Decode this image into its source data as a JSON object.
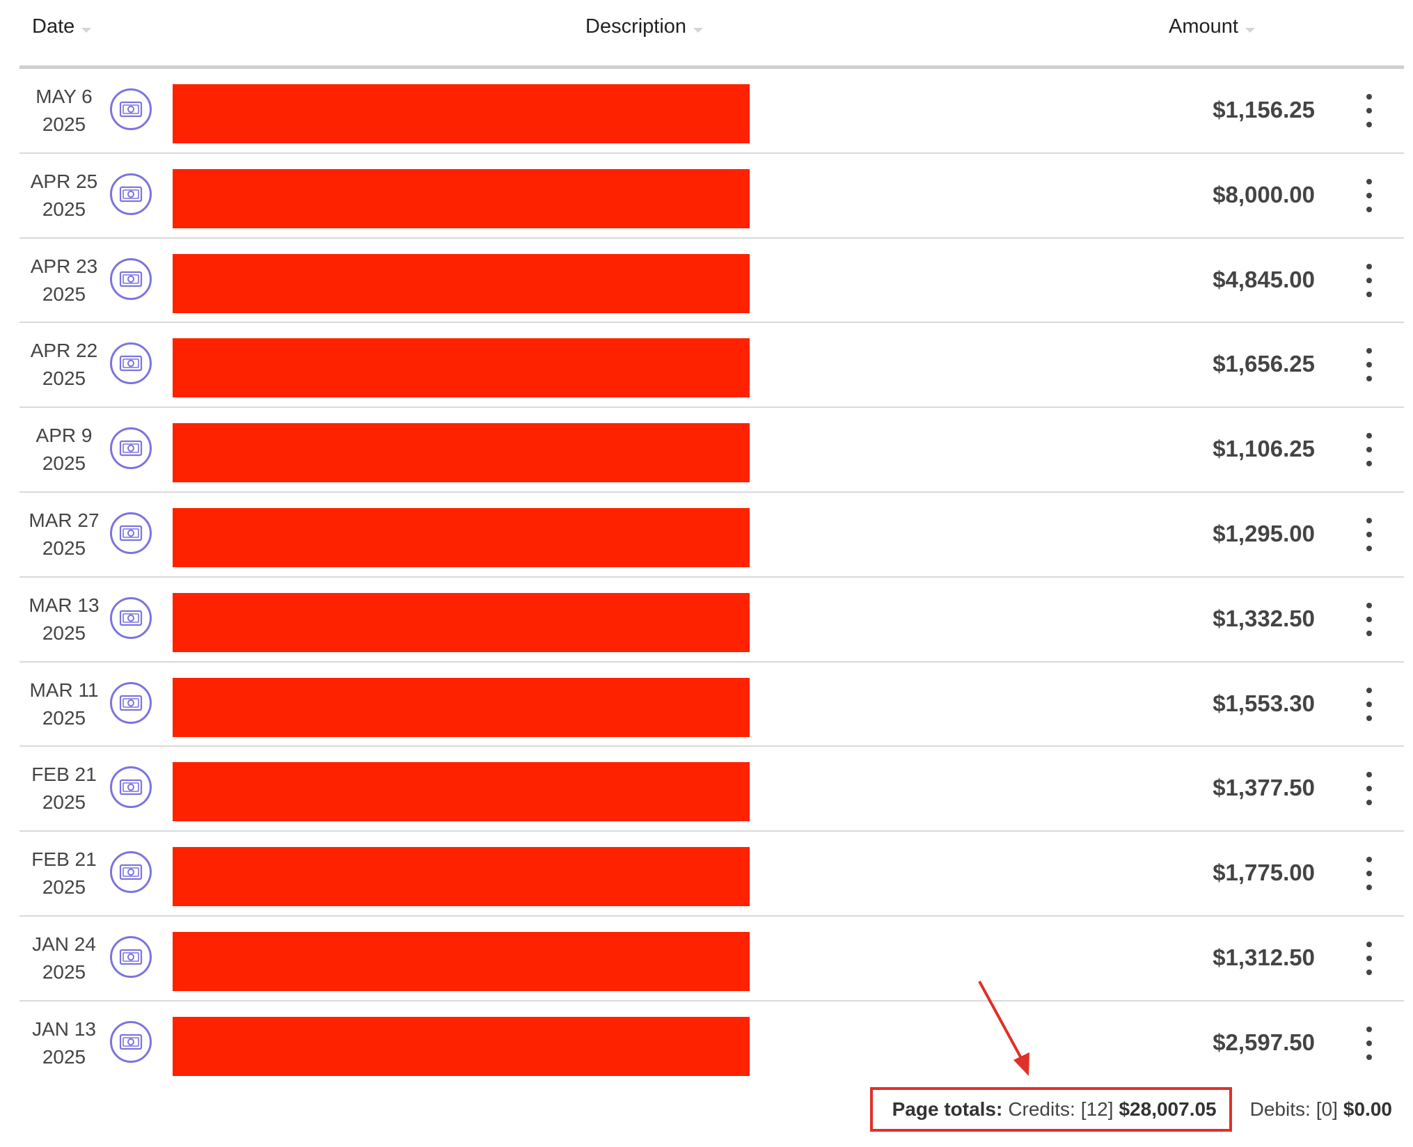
{
  "headers": {
    "date": "Date",
    "description": "Description",
    "amount": "Amount"
  },
  "rows": [
    {
      "date_md": "MAY 6",
      "year": "2025",
      "amount": "$1,156.25"
    },
    {
      "date_md": "APR 25",
      "year": "2025",
      "amount": "$8,000.00"
    },
    {
      "date_md": "APR 23",
      "year": "2025",
      "amount": "$4,845.00"
    },
    {
      "date_md": "APR 22",
      "year": "2025",
      "amount": "$1,656.25"
    },
    {
      "date_md": "APR 9",
      "year": "2025",
      "amount": "$1,106.25"
    },
    {
      "date_md": "MAR 27",
      "year": "2025",
      "amount": "$1,295.00"
    },
    {
      "date_md": "MAR 13",
      "year": "2025",
      "amount": "$1,332.50"
    },
    {
      "date_md": "MAR 11",
      "year": "2025",
      "amount": "$1,553.30"
    },
    {
      "date_md": "FEB 21",
      "year": "2025",
      "amount": "$1,377.50"
    },
    {
      "date_md": "FEB 21",
      "year": "2025",
      "amount": "$1,775.00"
    },
    {
      "date_md": "JAN 24",
      "year": "2025",
      "amount": "$1,312.50"
    },
    {
      "date_md": "JAN 13",
      "year": "2025",
      "amount": "$2,597.50"
    }
  ],
  "row_icon": "cash-icon",
  "totals": {
    "label": "Page totals:",
    "credits_label": "Credits:",
    "credits_count": "[12]",
    "credits_amount": "$28,007.05",
    "debits_label": "Debits:",
    "debits_count": "[0]",
    "debits_amount": "$0.00"
  },
  "colors": {
    "redaction": "#ff2200",
    "icon_accent": "#7b74e0",
    "annotation": "#e0302a"
  }
}
